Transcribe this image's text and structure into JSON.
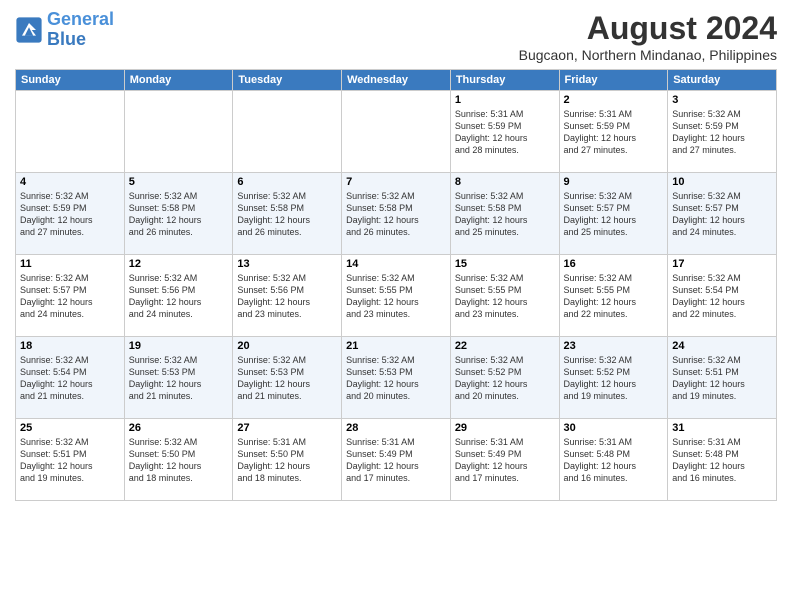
{
  "header": {
    "logo_line1": "General",
    "logo_line2": "Blue",
    "main_title": "August 2024",
    "subtitle": "Bugcaon, Northern Mindanao, Philippines"
  },
  "weekdays": [
    "Sunday",
    "Monday",
    "Tuesday",
    "Wednesday",
    "Thursday",
    "Friday",
    "Saturday"
  ],
  "weeks": [
    [
      {
        "day": "",
        "info": ""
      },
      {
        "day": "",
        "info": ""
      },
      {
        "day": "",
        "info": ""
      },
      {
        "day": "",
        "info": ""
      },
      {
        "day": "1",
        "info": "Sunrise: 5:31 AM\nSunset: 5:59 PM\nDaylight: 12 hours\nand 28 minutes."
      },
      {
        "day": "2",
        "info": "Sunrise: 5:31 AM\nSunset: 5:59 PM\nDaylight: 12 hours\nand 27 minutes."
      },
      {
        "day": "3",
        "info": "Sunrise: 5:32 AM\nSunset: 5:59 PM\nDaylight: 12 hours\nand 27 minutes."
      }
    ],
    [
      {
        "day": "4",
        "info": "Sunrise: 5:32 AM\nSunset: 5:59 PM\nDaylight: 12 hours\nand 27 minutes."
      },
      {
        "day": "5",
        "info": "Sunrise: 5:32 AM\nSunset: 5:58 PM\nDaylight: 12 hours\nand 26 minutes."
      },
      {
        "day": "6",
        "info": "Sunrise: 5:32 AM\nSunset: 5:58 PM\nDaylight: 12 hours\nand 26 minutes."
      },
      {
        "day": "7",
        "info": "Sunrise: 5:32 AM\nSunset: 5:58 PM\nDaylight: 12 hours\nand 26 minutes."
      },
      {
        "day": "8",
        "info": "Sunrise: 5:32 AM\nSunset: 5:58 PM\nDaylight: 12 hours\nand 25 minutes."
      },
      {
        "day": "9",
        "info": "Sunrise: 5:32 AM\nSunset: 5:57 PM\nDaylight: 12 hours\nand 25 minutes."
      },
      {
        "day": "10",
        "info": "Sunrise: 5:32 AM\nSunset: 5:57 PM\nDaylight: 12 hours\nand 24 minutes."
      }
    ],
    [
      {
        "day": "11",
        "info": "Sunrise: 5:32 AM\nSunset: 5:57 PM\nDaylight: 12 hours\nand 24 minutes."
      },
      {
        "day": "12",
        "info": "Sunrise: 5:32 AM\nSunset: 5:56 PM\nDaylight: 12 hours\nand 24 minutes."
      },
      {
        "day": "13",
        "info": "Sunrise: 5:32 AM\nSunset: 5:56 PM\nDaylight: 12 hours\nand 23 minutes."
      },
      {
        "day": "14",
        "info": "Sunrise: 5:32 AM\nSunset: 5:55 PM\nDaylight: 12 hours\nand 23 minutes."
      },
      {
        "day": "15",
        "info": "Sunrise: 5:32 AM\nSunset: 5:55 PM\nDaylight: 12 hours\nand 23 minutes."
      },
      {
        "day": "16",
        "info": "Sunrise: 5:32 AM\nSunset: 5:55 PM\nDaylight: 12 hours\nand 22 minutes."
      },
      {
        "day": "17",
        "info": "Sunrise: 5:32 AM\nSunset: 5:54 PM\nDaylight: 12 hours\nand 22 minutes."
      }
    ],
    [
      {
        "day": "18",
        "info": "Sunrise: 5:32 AM\nSunset: 5:54 PM\nDaylight: 12 hours\nand 21 minutes."
      },
      {
        "day": "19",
        "info": "Sunrise: 5:32 AM\nSunset: 5:53 PM\nDaylight: 12 hours\nand 21 minutes."
      },
      {
        "day": "20",
        "info": "Sunrise: 5:32 AM\nSunset: 5:53 PM\nDaylight: 12 hours\nand 21 minutes."
      },
      {
        "day": "21",
        "info": "Sunrise: 5:32 AM\nSunset: 5:53 PM\nDaylight: 12 hours\nand 20 minutes."
      },
      {
        "day": "22",
        "info": "Sunrise: 5:32 AM\nSunset: 5:52 PM\nDaylight: 12 hours\nand 20 minutes."
      },
      {
        "day": "23",
        "info": "Sunrise: 5:32 AM\nSunset: 5:52 PM\nDaylight: 12 hours\nand 19 minutes."
      },
      {
        "day": "24",
        "info": "Sunrise: 5:32 AM\nSunset: 5:51 PM\nDaylight: 12 hours\nand 19 minutes."
      }
    ],
    [
      {
        "day": "25",
        "info": "Sunrise: 5:32 AM\nSunset: 5:51 PM\nDaylight: 12 hours\nand 19 minutes."
      },
      {
        "day": "26",
        "info": "Sunrise: 5:32 AM\nSunset: 5:50 PM\nDaylight: 12 hours\nand 18 minutes."
      },
      {
        "day": "27",
        "info": "Sunrise: 5:31 AM\nSunset: 5:50 PM\nDaylight: 12 hours\nand 18 minutes."
      },
      {
        "day": "28",
        "info": "Sunrise: 5:31 AM\nSunset: 5:49 PM\nDaylight: 12 hours\nand 17 minutes."
      },
      {
        "day": "29",
        "info": "Sunrise: 5:31 AM\nSunset: 5:49 PM\nDaylight: 12 hours\nand 17 minutes."
      },
      {
        "day": "30",
        "info": "Sunrise: 5:31 AM\nSunset: 5:48 PM\nDaylight: 12 hours\nand 16 minutes."
      },
      {
        "day": "31",
        "info": "Sunrise: 5:31 AM\nSunset: 5:48 PM\nDaylight: 12 hours\nand 16 minutes."
      }
    ]
  ]
}
